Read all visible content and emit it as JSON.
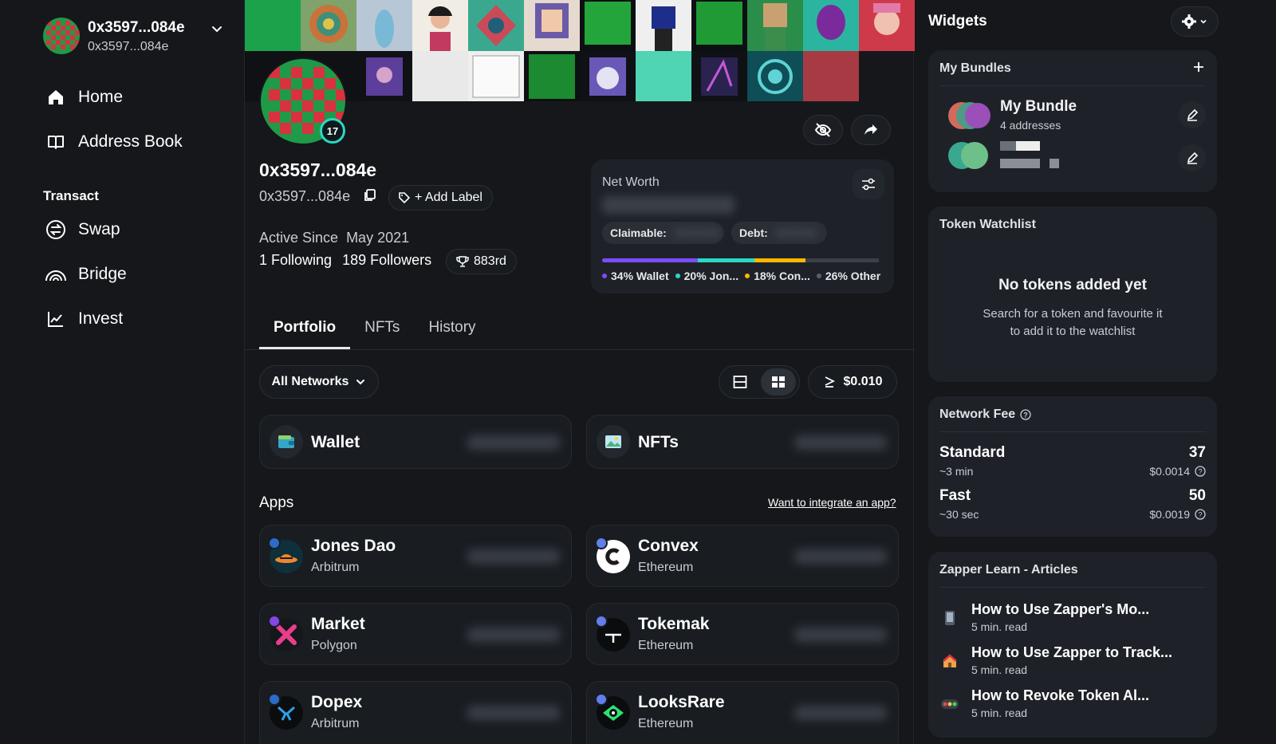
{
  "account": {
    "name": "0x3597...084e",
    "address": "0x3597...084e"
  },
  "nav": {
    "items": [
      {
        "label": "Home",
        "icon": "home-icon"
      },
      {
        "label": "Address Book",
        "icon": "book-icon"
      }
    ],
    "section_label": "Transact",
    "transact_items": [
      {
        "label": "Swap",
        "icon": "swap-icon"
      },
      {
        "label": "Bridge",
        "icon": "bridge-icon"
      },
      {
        "label": "Invest",
        "icon": "chart-line-icon"
      }
    ]
  },
  "profile": {
    "name": "0x3597...084e",
    "address": "0x3597...084e",
    "level": "17",
    "add_label": "+ Add Label",
    "active_since_label": "Active Since",
    "active_since_value": "May 2021",
    "following": "1 Following",
    "followers": "189 Followers",
    "rank": "883rd"
  },
  "net_worth": {
    "label": "Net Worth",
    "claimable_label": "Claimable:",
    "debt_label": "Debt:",
    "breakdown": [
      {
        "label": "34% Wallet",
        "pct": 34,
        "color": "#7b4dff"
      },
      {
        "label": "20% Jon...",
        "pct": 20,
        "color": "#2ad8c5"
      },
      {
        "label": "18% Con...",
        "pct": 18,
        "color": "#ffb800"
      },
      {
        "label": "26% Other",
        "pct": 26,
        "color": "#3a3f48"
      }
    ]
  },
  "tabs": [
    {
      "label": "Portfolio",
      "active": true
    },
    {
      "label": "NFTs",
      "active": false
    },
    {
      "label": "History",
      "active": false
    }
  ],
  "filters": {
    "network": "All Networks",
    "threshold": "$0.010"
  },
  "summary_cards": [
    {
      "label": "Wallet",
      "icon": "wallet-icon"
    },
    {
      "label": "NFTs",
      "icon": "image-icon"
    }
  ],
  "apps": {
    "title": "Apps",
    "integrate_link": "Want to integrate an app?",
    "items": [
      {
        "name": "Jones Dao",
        "network": "Arbitrum"
      },
      {
        "name": "Convex",
        "network": "Ethereum"
      },
      {
        "name": "Market",
        "network": "Polygon"
      },
      {
        "name": "Tokemak",
        "network": "Ethereum"
      },
      {
        "name": "Dopex",
        "network": "Arbitrum"
      },
      {
        "name": "LooksRare",
        "network": "Ethereum"
      }
    ]
  },
  "widgets": {
    "title": "Widgets",
    "bundles": {
      "title": "My Bundles",
      "items": [
        {
          "name": "My Bundle",
          "sub": "4 addresses"
        }
      ]
    },
    "watchlist": {
      "title": "Token Watchlist",
      "empty_title": "No tokens added yet",
      "empty_line1": "Search for a token and favourite it",
      "empty_line2": "to add it to the watchlist"
    },
    "network_fee": {
      "title": "Network Fee",
      "rows": [
        {
          "name": "Standard",
          "time": "~3 min",
          "gwei": "37",
          "usd": "$0.0014"
        },
        {
          "name": "Fast",
          "time": "~30 sec",
          "gwei": "50",
          "usd": "$0.0019"
        }
      ]
    },
    "learn": {
      "title": "Zapper Learn - Articles",
      "items": [
        {
          "title": "How to Use Zapper's Mo...",
          "sub": "5 min. read",
          "icon": "phone-icon"
        },
        {
          "title": "How to Use Zapper to Track...",
          "sub": "5 min. read",
          "icon": "house-icon"
        },
        {
          "title": "How to Revoke Token Al...",
          "sub": "5 min. read",
          "icon": "traffic-icon"
        }
      ]
    }
  }
}
